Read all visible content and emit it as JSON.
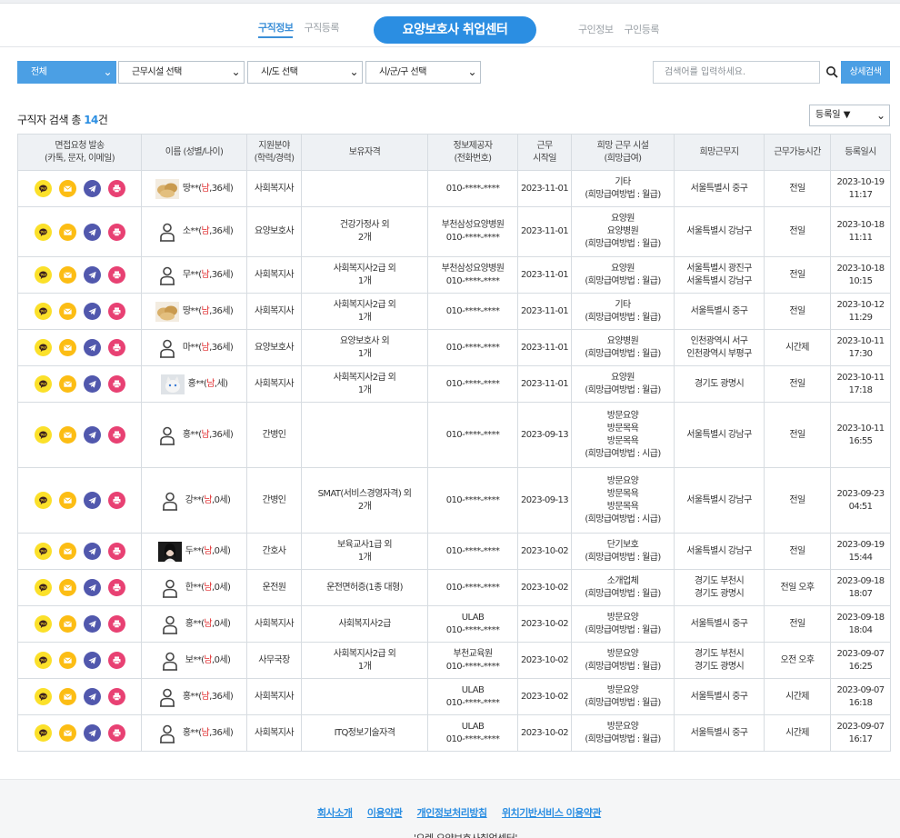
{
  "nav": {
    "left": [
      "구직정보",
      "구직등록"
    ],
    "logo": "요양보호사 취업센터",
    "right": [
      "구인정보",
      "구인등록"
    ]
  },
  "filters": {
    "category": "전체",
    "facility": "근무시설 선택",
    "city": "시/도 선택",
    "district": "시/군/구 선택",
    "search_placeholder": "검색어를 입력하세요.",
    "search_button": "상세검색"
  },
  "result": {
    "prefix": "구직자 검색 총 ",
    "count": "14",
    "suffix": "건"
  },
  "sort": "등록일 ▼",
  "table": {
    "headers": [
      "면접요청 발송\n(카톡, 문자, 이메일)",
      "이름 (성별/나이)",
      "지원분야\n(학력/경력)",
      "보유자격",
      "정보제공자\n(전화번호)",
      "근무\n시작일",
      "희망 근무 시설\n(희망급여)",
      "희망근무지",
      "근무가능시간",
      "등록일시"
    ],
    "rows": [
      {
        "avatar": "food",
        "name": "땅**",
        "g": "남",
        "age": "36세",
        "field": "사회복지사",
        "qual": "",
        "prov": "010-****-****",
        "start": "2023-11-01",
        "fac": "기타\n(희망급여방법 : 월급)",
        "loc": "서울특별시 중구",
        "time": "전일",
        "reg": "2023-10-19\n11:17"
      },
      {
        "avatar": "person",
        "name": "소**",
        "g": "남",
        "age": "36세",
        "field": "요양보호사",
        "qual": "건강가정사 외\n2개",
        "prov": "부천삼성요양병원\n010-****-****",
        "start": "2023-11-01",
        "fac": "요양원\n요양병원\n(희망급여방법 : 월급)",
        "loc": "서울특별시 강남구",
        "time": "전일",
        "reg": "2023-10-18\n11:11"
      },
      {
        "avatar": "person",
        "name": "무**",
        "g": "남",
        "age": "36세",
        "field": "사회복지사",
        "qual": "사회복지사2급 외\n1개",
        "prov": "부천삼성요양병원\n010-****-****",
        "start": "2023-11-01",
        "fac": "요양원\n(희망급여방법 : 월급)",
        "loc": "서울특별시 광진구\n서울특별시 강남구",
        "time": "전일",
        "reg": "2023-10-18\n10:15"
      },
      {
        "avatar": "food",
        "name": "땅**",
        "g": "남",
        "age": "36세",
        "field": "사회복지사",
        "qual": "사회복지사2급 외\n1개",
        "prov": "010-****-****",
        "start": "2023-11-01",
        "fac": "기타\n(희망급여방법 : 월급)",
        "loc": "서울특별시 중구",
        "time": "전일",
        "reg": "2023-10-12\n11:29"
      },
      {
        "avatar": "person",
        "name": "마**",
        "g": "남",
        "age": "36세",
        "field": "요양보호사",
        "qual": "요양보호사 외\n1개",
        "prov": "010-****-****",
        "start": "2023-11-01",
        "fac": "요양병원\n(희망급여방법 : 월급)",
        "loc": "인천광역시 서구\n인천광역시 부평구",
        "time": "시간제",
        "reg": "2023-10-11\n17:30"
      },
      {
        "avatar": "cat",
        "name": "홍**",
        "g": "남",
        "age": "세",
        "field": "사회복지사",
        "qual": "사회복지사2급 외\n1개",
        "prov": "010-****-****",
        "start": "2023-11-01",
        "fac": "요양원\n(희망급여방법 : 월급)",
        "loc": "경기도 광명시",
        "time": "전일",
        "reg": "2023-10-11\n17:18"
      },
      {
        "avatar": "person",
        "name": "홍**",
        "g": "남",
        "age": "36세",
        "field": "간병인",
        "qual": "",
        "prov": "010-****-****",
        "start": "2023-09-13",
        "fac": "방문요양\n방문목욕\n방문목욕\n(희망급여방법 : 시급)",
        "loc": "서울특별시 강남구",
        "time": "전일",
        "reg": "2023-10-11\n16:55"
      },
      {
        "avatar": "person",
        "name": "강**",
        "g": "남",
        "age": "0세",
        "field": "간병인",
        "qual": "SMAT(서비스경영자격) 외\n2개",
        "prov": "010-****-****",
        "start": "2023-09-13",
        "fac": "방문요양\n방문목욕\n방문목욕\n(희망급여방법 : 시급)",
        "loc": "서울특별시 강남구",
        "time": "전일",
        "reg": "2023-09-23\n04:51"
      },
      {
        "avatar": "photo",
        "name": "두**",
        "g": "남",
        "age": "0세",
        "field": "간호사",
        "qual": "보육교사1급 외\n1개",
        "prov": "010-****-****",
        "start": "2023-10-02",
        "fac": "단기보호\n(희망급여방법 : 월급)",
        "loc": "서울특별시 강남구",
        "time": "전일",
        "reg": "2023-09-19\n15:44"
      },
      {
        "avatar": "person",
        "name": "한**",
        "g": "남",
        "age": "0세",
        "field": "운전원",
        "qual": "운전면허증(1종 대형)",
        "prov": "010-****-****",
        "start": "2023-10-02",
        "fac": "소개업체\n(희망급여방법 : 월급)",
        "loc": "경기도 부천시\n경기도 광명시",
        "time": "전일 오후",
        "reg": "2023-09-18\n18:07"
      },
      {
        "avatar": "person",
        "name": "홍**",
        "g": "남",
        "age": "0세",
        "field": "사회복지사",
        "qual": "사회복지사2급",
        "prov": "ULAB\n010-****-****",
        "start": "2023-10-02",
        "fac": "방문요양\n(희망급여방법 : 월급)",
        "loc": "서울특별시 중구",
        "time": "전일",
        "reg": "2023-09-18\n18:04"
      },
      {
        "avatar": "person",
        "name": "보**",
        "g": "남",
        "age": "0세",
        "field": "사무국장",
        "qual": "사회복지사2급 외\n1개",
        "prov": "부천교육원\n010-****-****",
        "start": "2023-10-02",
        "fac": "방문요양\n(희망급여방법 : 월급)",
        "loc": "경기도 부천시\n경기도 광명시",
        "time": "오전 오후",
        "reg": "2023-09-07\n16:25"
      },
      {
        "avatar": "person",
        "name": "홍**",
        "g": "남",
        "age": "36세",
        "field": "사회복지사",
        "qual": "",
        "prov": "ULAB\n010-****-****",
        "start": "2023-10-02",
        "fac": "방문요양\n(희망급여방법 : 월급)",
        "loc": "서울특별시 중구",
        "time": "시간제",
        "reg": "2023-09-07\n16:18"
      },
      {
        "avatar": "person",
        "name": "홍**",
        "g": "남",
        "age": "36세",
        "field": "사회복지사",
        "qual": "ITQ정보기술자격",
        "prov": "ULAB\n010-****-****",
        "start": "2023-10-02",
        "fac": "방문요양\n(희망급여방법 : 월급)",
        "loc": "서울특별시 중구",
        "time": "시간제",
        "reg": "2023-09-07\n16:17"
      }
    ]
  },
  "footer": {
    "links": [
      "회사소개",
      "이용약관",
      "개인정보처리방침",
      "위치기반서비스 이용약관"
    ],
    "copy": "'오렌 요양보호사취업센터'"
  },
  "colors": {
    "accent": "#2b8ee2",
    "kakao": "#fbe02a",
    "sms": "#fcbd14",
    "telegram": "#5158ad",
    "print": "#e84173"
  }
}
